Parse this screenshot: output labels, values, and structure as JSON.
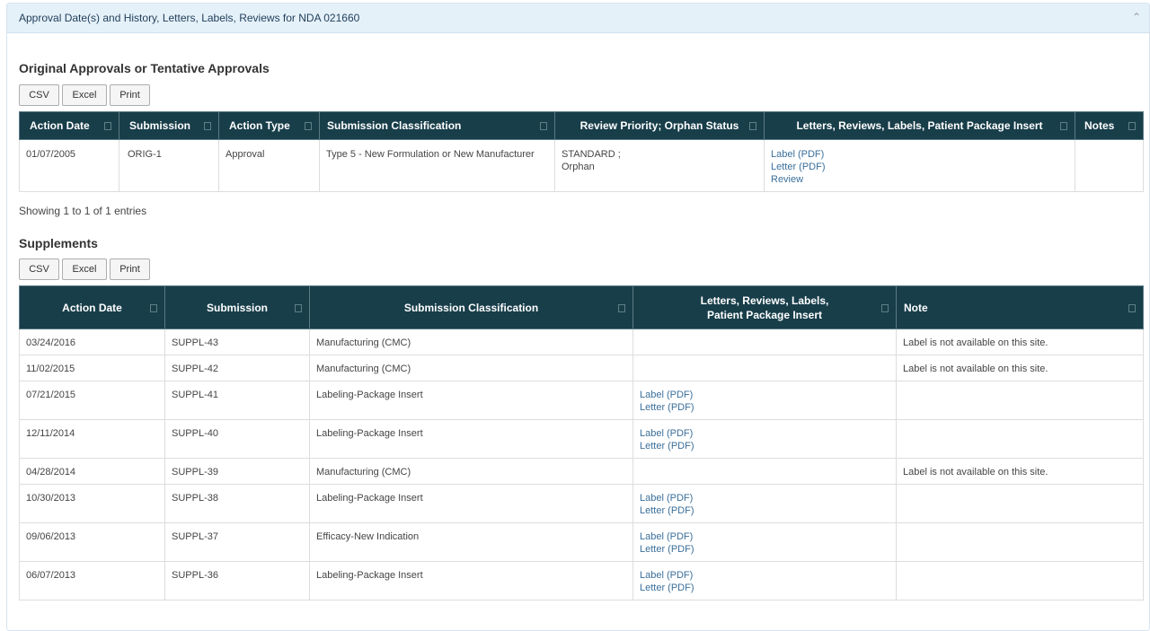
{
  "panel": {
    "title": "Approval Date(s) and History, Letters, Labels, Reviews for NDA 021660"
  },
  "original": {
    "heading": "Original Approvals or Tentative Approvals",
    "buttons": [
      "CSV",
      "Excel",
      "Print"
    ],
    "columns": [
      "Action Date",
      "Submission",
      "Action Type",
      "Submission Classification",
      "Review Priority; Orphan Status",
      "Letters, Reviews, Labels, Patient Package Insert",
      "Notes"
    ],
    "rows": [
      {
        "date": "01/07/2005",
        "submission": "ORIG-1",
        "action_type": "Approval",
        "classification": "Type 5 - New Formulation or New Manufacturer",
        "priority_line1": "STANDARD ;",
        "priority_line2": "Orphan",
        "links": [
          "Label (PDF)",
          "Letter (PDF)",
          "Review"
        ],
        "notes": ""
      }
    ],
    "showing": "Showing 1 to 1 of 1 entries"
  },
  "supplements": {
    "heading": "Supplements",
    "buttons": [
      "CSV",
      "Excel",
      "Print"
    ],
    "columns": [
      "Action Date",
      "Submission",
      "Submission Classification",
      "Letters, Reviews, Labels,",
      "Patient Package Insert",
      "Note"
    ],
    "rows": [
      {
        "date": "03/24/2016",
        "submission": "SUPPL-43",
        "classification": "Manufacturing (CMC)",
        "link1": "",
        "link2": "",
        "note": "Label is not available on this site."
      },
      {
        "date": "11/02/2015",
        "submission": "SUPPL-42",
        "classification": "Manufacturing (CMC)",
        "link1": "",
        "link2": "",
        "note": "Label is not available on this site."
      },
      {
        "date": "07/21/2015",
        "submission": "SUPPL-41",
        "classification": "Labeling-Package Insert",
        "link1": "Label (PDF)",
        "link2": "Letter (PDF)",
        "note": ""
      },
      {
        "date": "12/11/2014",
        "submission": "SUPPL-40",
        "classification": "Labeling-Package Insert",
        "link1": "Label (PDF)",
        "link2": "Letter (PDF)",
        "note": ""
      },
      {
        "date": "04/28/2014",
        "submission": "SUPPL-39",
        "classification": "Manufacturing (CMC)",
        "link1": "",
        "link2": "",
        "note": "Label is not available on this site."
      },
      {
        "date": "10/30/2013",
        "submission": "SUPPL-38",
        "classification": "Labeling-Package Insert",
        "link1": "Label (PDF)",
        "link2": "Letter (PDF)",
        "note": ""
      },
      {
        "date": "09/06/2013",
        "submission": "SUPPL-37",
        "classification": "Efficacy-New Indication",
        "link1": "Label (PDF)",
        "link2": "Letter (PDF)",
        "note": ""
      },
      {
        "date": "06/07/2013",
        "submission": "SUPPL-36",
        "classification": "Labeling-Package Insert",
        "link1": "Label (PDF)",
        "link2": "Letter (PDF)",
        "note": ""
      }
    ]
  }
}
